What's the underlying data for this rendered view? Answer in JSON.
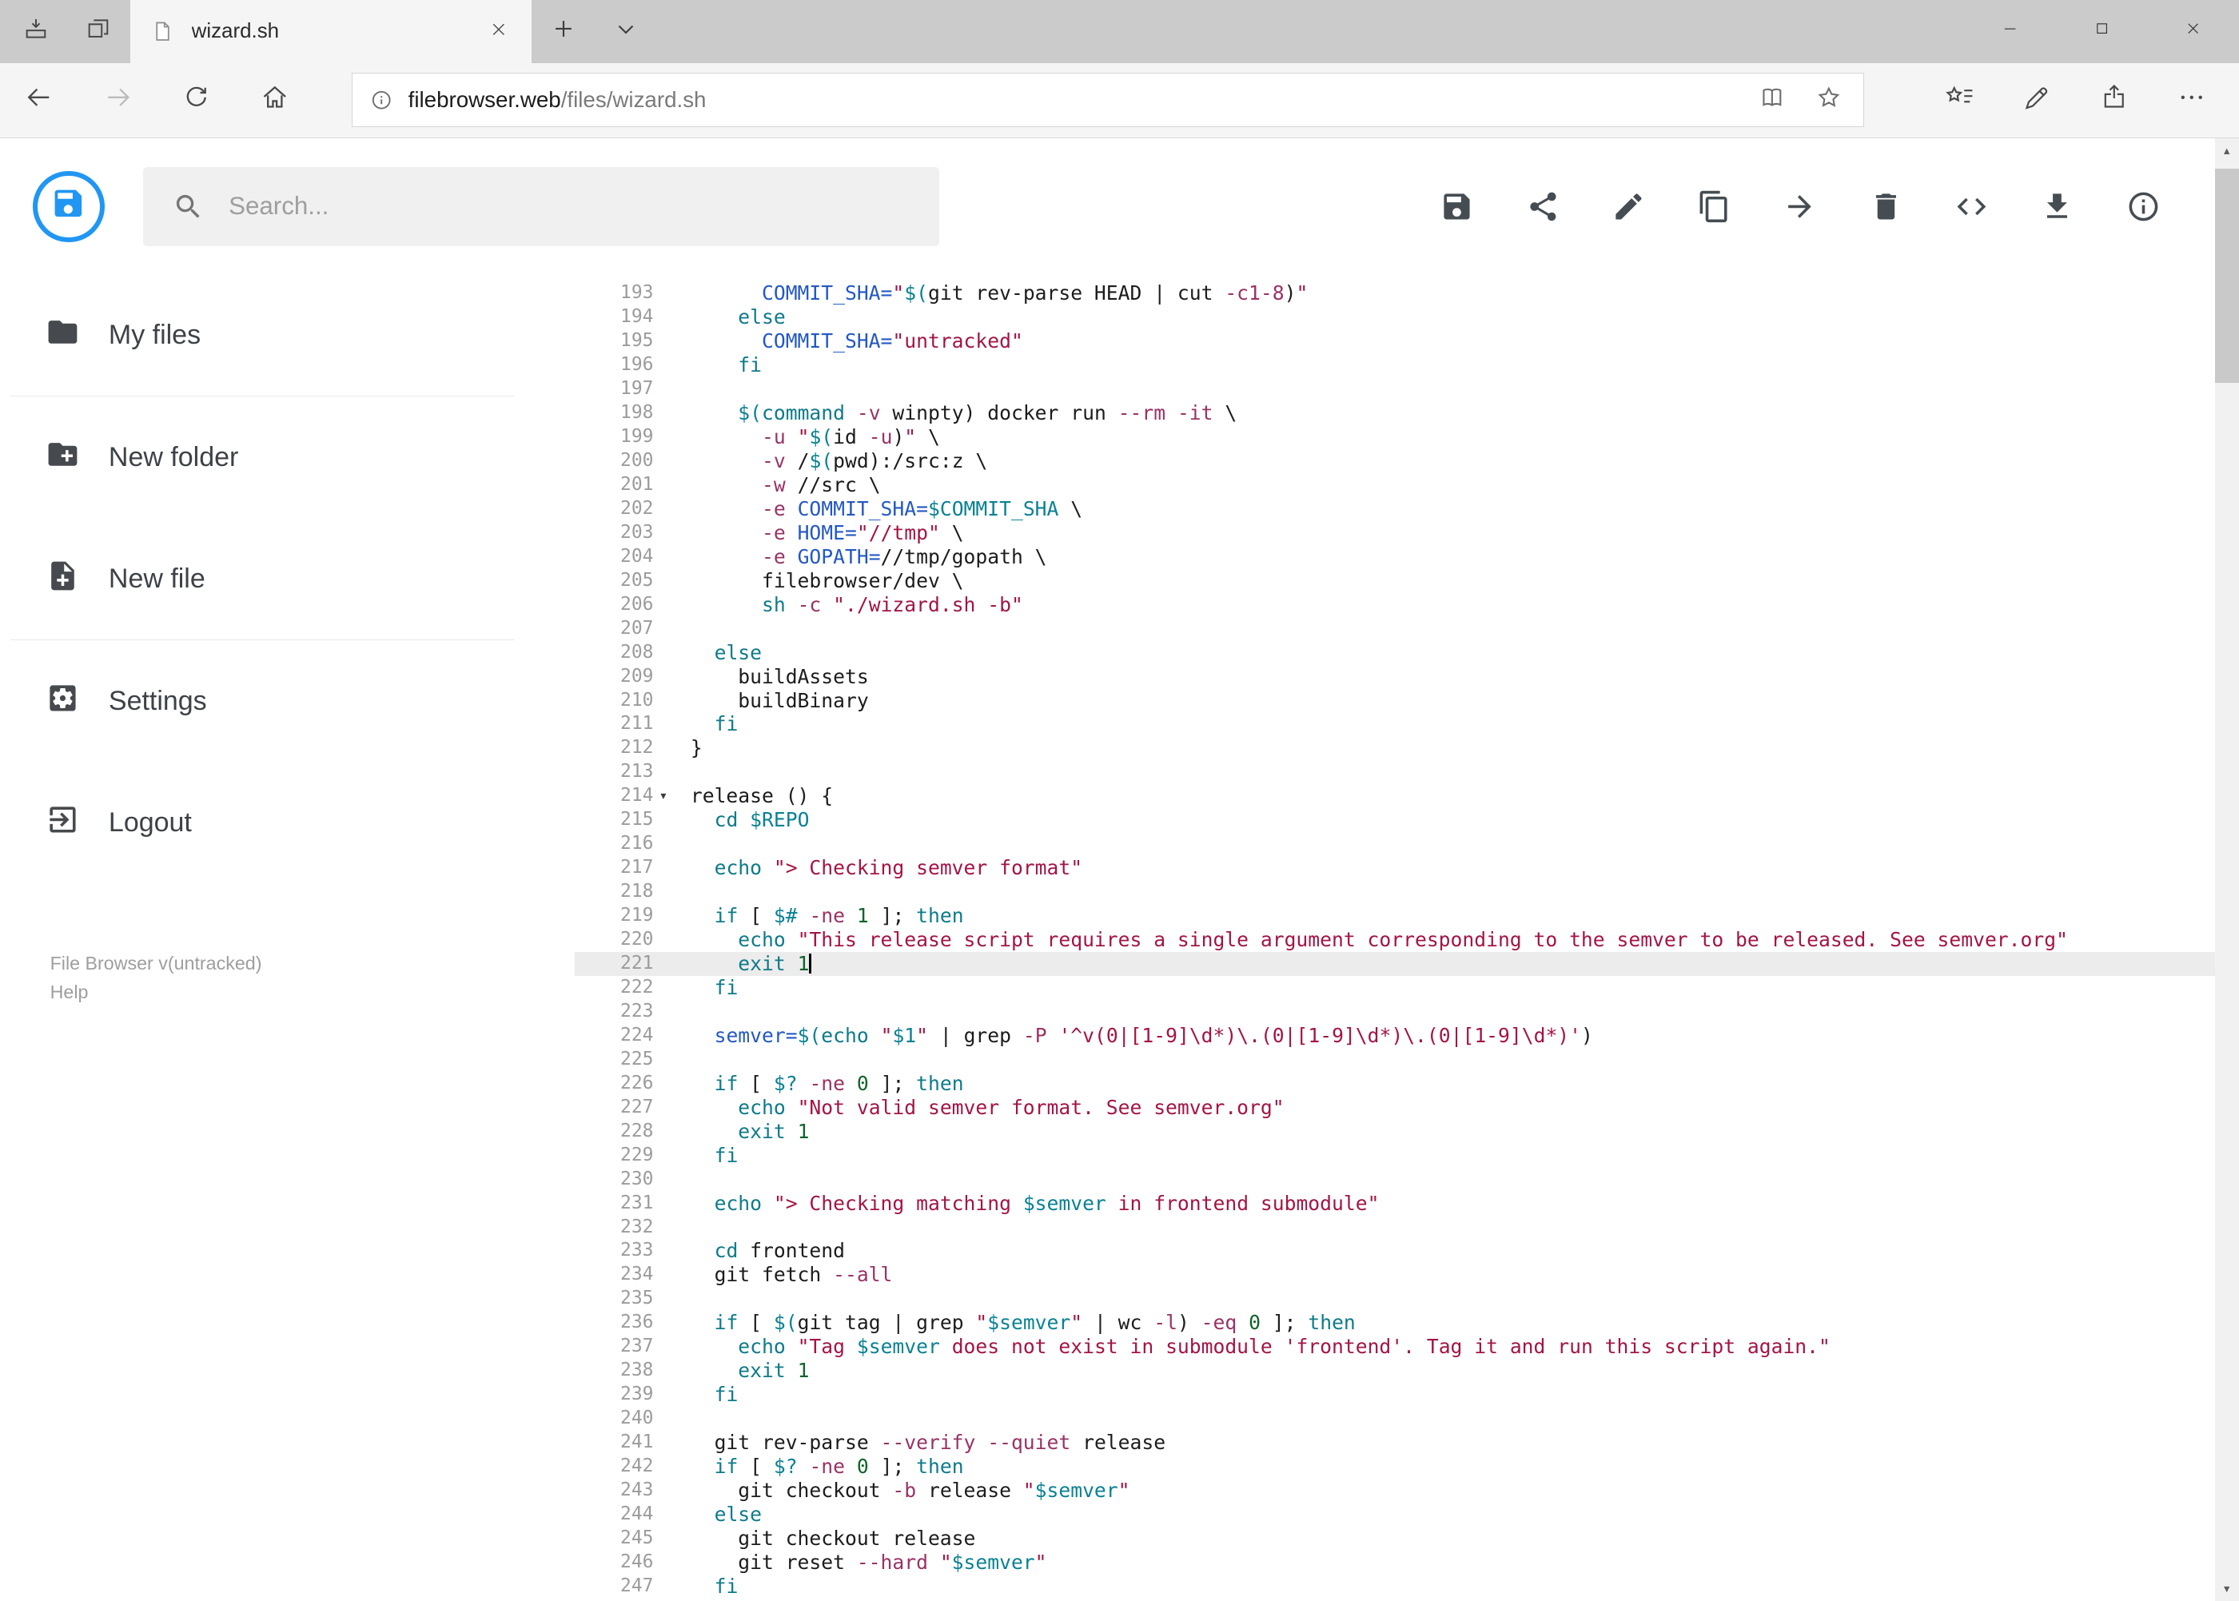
{
  "browser": {
    "tab_title": "wizard.sh",
    "address": {
      "host": "filebrowser.web",
      "path": "/files/wizard.sh"
    }
  },
  "app": {
    "search": {
      "placeholder": "Search..."
    },
    "toolbar_icons": [
      "save",
      "share",
      "edit",
      "copy",
      "move",
      "delete",
      "raw",
      "download",
      "info"
    ],
    "sidebar": {
      "items": [
        {
          "label": "My files"
        },
        {
          "label": "New folder"
        },
        {
          "label": "New file"
        },
        {
          "label": "Settings"
        },
        {
          "label": "Logout"
        }
      ],
      "footer": {
        "version": "File Browser v(untracked)",
        "help": "Help"
      }
    }
  },
  "theme": {
    "accent": "#2196f3",
    "active_line_bg": "#ececec",
    "tok_plain": "#1c1c1c",
    "tok_keyword": "#0e7b8a",
    "tok_string": "#a31545",
    "tok_def": "#2458c5",
    "tok_variable": "#0a8293",
    "tok_number": "#11632a",
    "tok_flag": "#993366"
  },
  "editor": {
    "active_line": 221,
    "cursor_line": 221,
    "fold_marker_line": 214,
    "fold_marker": "▾",
    "lines": [
      {
        "n": 193,
        "t": [
          [
            "p",
            "      "
          ],
          [
            "d",
            "COMMIT_SHA="
          ],
          [
            "s",
            "\""
          ],
          [
            "v",
            "$("
          ],
          [
            "p",
            "git rev-parse HEAD | cut "
          ],
          [
            "f",
            "-c1-8"
          ],
          [
            "p",
            ")"
          ],
          [
            "s",
            "\""
          ]
        ]
      },
      {
        "n": 194,
        "t": [
          [
            "p",
            "    "
          ],
          [
            "k",
            "else"
          ]
        ]
      },
      {
        "n": 195,
        "t": [
          [
            "p",
            "      "
          ],
          [
            "d",
            "COMMIT_SHA="
          ],
          [
            "s",
            "\"untracked\""
          ]
        ]
      },
      {
        "n": 196,
        "t": [
          [
            "p",
            "    "
          ],
          [
            "k",
            "fi"
          ]
        ]
      },
      {
        "n": 197,
        "t": []
      },
      {
        "n": 198,
        "t": [
          [
            "p",
            "    "
          ],
          [
            "v",
            "$("
          ],
          [
            "k",
            "command"
          ],
          [
            "p",
            " "
          ],
          [
            "f",
            "-v"
          ],
          [
            "p",
            " winpty) docker run "
          ],
          [
            "f",
            "--rm"
          ],
          [
            "p",
            " "
          ],
          [
            "f",
            "-it"
          ],
          [
            "p",
            " \\"
          ]
        ]
      },
      {
        "n": 199,
        "t": [
          [
            "p",
            "      "
          ],
          [
            "f",
            "-u"
          ],
          [
            "p",
            " "
          ],
          [
            "s",
            "\""
          ],
          [
            "v",
            "$("
          ],
          [
            "p",
            "id "
          ],
          [
            "f",
            "-u"
          ],
          [
            "p",
            ")"
          ],
          [
            "s",
            "\""
          ],
          [
            "p",
            " \\"
          ]
        ]
      },
      {
        "n": 200,
        "t": [
          [
            "p",
            "      "
          ],
          [
            "f",
            "-v"
          ],
          [
            "p",
            " /"
          ],
          [
            "v",
            "$("
          ],
          [
            "p",
            "pwd):/src:z \\"
          ]
        ]
      },
      {
        "n": 201,
        "t": [
          [
            "p",
            "      "
          ],
          [
            "f",
            "-w"
          ],
          [
            "p",
            " //src \\"
          ]
        ]
      },
      {
        "n": 202,
        "t": [
          [
            "p",
            "      "
          ],
          [
            "f",
            "-e"
          ],
          [
            "p",
            " "
          ],
          [
            "d",
            "COMMIT_SHA="
          ],
          [
            "v",
            "$COMMIT_SHA"
          ],
          [
            "p",
            " \\"
          ]
        ]
      },
      {
        "n": 203,
        "t": [
          [
            "p",
            "      "
          ],
          [
            "f",
            "-e"
          ],
          [
            "p",
            " "
          ],
          [
            "d",
            "HOME="
          ],
          [
            "s",
            "\"//tmp\""
          ],
          [
            "p",
            " \\"
          ]
        ]
      },
      {
        "n": 204,
        "t": [
          [
            "p",
            "      "
          ],
          [
            "f",
            "-e"
          ],
          [
            "p",
            " "
          ],
          [
            "d",
            "GOPATH="
          ],
          [
            "p",
            "//tmp/gopath \\"
          ]
        ]
      },
      {
        "n": 205,
        "t": [
          [
            "p",
            "      filebrowser/dev \\"
          ]
        ]
      },
      {
        "n": 206,
        "t": [
          [
            "p",
            "      "
          ],
          [
            "k",
            "sh"
          ],
          [
            "p",
            " "
          ],
          [
            "f",
            "-c"
          ],
          [
            "p",
            " "
          ],
          [
            "s",
            "\"./wizard.sh -b\""
          ]
        ]
      },
      {
        "n": 207,
        "t": []
      },
      {
        "n": 208,
        "t": [
          [
            "p",
            "  "
          ],
          [
            "k",
            "else"
          ]
        ]
      },
      {
        "n": 209,
        "t": [
          [
            "p",
            "    buildAssets"
          ]
        ]
      },
      {
        "n": 210,
        "t": [
          [
            "p",
            "    buildBinary"
          ]
        ]
      },
      {
        "n": 211,
        "t": [
          [
            "p",
            "  "
          ],
          [
            "k",
            "fi"
          ]
        ]
      },
      {
        "n": 212,
        "t": [
          [
            "p",
            "}"
          ]
        ]
      },
      {
        "n": 213,
        "t": []
      },
      {
        "n": 214,
        "t": [
          [
            "p",
            "release () {"
          ]
        ]
      },
      {
        "n": 215,
        "t": [
          [
            "p",
            "  "
          ],
          [
            "k",
            "cd"
          ],
          [
            "p",
            " "
          ],
          [
            "v",
            "$REPO"
          ]
        ]
      },
      {
        "n": 216,
        "t": []
      },
      {
        "n": 217,
        "t": [
          [
            "p",
            "  "
          ],
          [
            "k",
            "echo"
          ],
          [
            "p",
            " "
          ],
          [
            "s",
            "\"> Checking semver format\""
          ]
        ]
      },
      {
        "n": 218,
        "t": []
      },
      {
        "n": 219,
        "t": [
          [
            "p",
            "  "
          ],
          [
            "k",
            "if"
          ],
          [
            "p",
            " [ "
          ],
          [
            "v",
            "$#"
          ],
          [
            "p",
            " "
          ],
          [
            "f",
            "-ne"
          ],
          [
            "p",
            " "
          ],
          [
            "n",
            "1"
          ],
          [
            "p",
            " ]; "
          ],
          [
            "k",
            "then"
          ]
        ]
      },
      {
        "n": 220,
        "t": [
          [
            "p",
            "    "
          ],
          [
            "k",
            "echo"
          ],
          [
            "p",
            " "
          ],
          [
            "s",
            "\"This release script requires a single argument corresponding to the semver to be released. See semver.org\""
          ]
        ]
      },
      {
        "n": 221,
        "t": [
          [
            "p",
            "    "
          ],
          [
            "k",
            "exit"
          ],
          [
            "p",
            " "
          ],
          [
            "n",
            "1"
          ]
        ]
      },
      {
        "n": 222,
        "t": [
          [
            "p",
            "  "
          ],
          [
            "k",
            "fi"
          ]
        ]
      },
      {
        "n": 223,
        "t": []
      },
      {
        "n": 224,
        "t": [
          [
            "p",
            "  "
          ],
          [
            "d",
            "semver="
          ],
          [
            "v",
            "$("
          ],
          [
            "k",
            "echo"
          ],
          [
            "p",
            " "
          ],
          [
            "s",
            "\""
          ],
          [
            "v",
            "$1"
          ],
          [
            "s",
            "\""
          ],
          [
            "p",
            " | grep "
          ],
          [
            "f",
            "-P"
          ],
          [
            "p",
            " "
          ],
          [
            "s",
            "'^v(0|[1-9]\\d*)\\.(0|[1-9]\\d*)\\.(0|[1-9]\\d*)'"
          ],
          [
            "p",
            ")"
          ]
        ]
      },
      {
        "n": 225,
        "t": []
      },
      {
        "n": 226,
        "t": [
          [
            "p",
            "  "
          ],
          [
            "k",
            "if"
          ],
          [
            "p",
            " [ "
          ],
          [
            "v",
            "$?"
          ],
          [
            "p",
            " "
          ],
          [
            "f",
            "-ne"
          ],
          [
            "p",
            " "
          ],
          [
            "n",
            "0"
          ],
          [
            "p",
            " ]; "
          ],
          [
            "k",
            "then"
          ]
        ]
      },
      {
        "n": 227,
        "t": [
          [
            "p",
            "    "
          ],
          [
            "k",
            "echo"
          ],
          [
            "p",
            " "
          ],
          [
            "s",
            "\"Not valid semver format. See semver.org\""
          ]
        ]
      },
      {
        "n": 228,
        "t": [
          [
            "p",
            "    "
          ],
          [
            "k",
            "exit"
          ],
          [
            "p",
            " "
          ],
          [
            "n",
            "1"
          ]
        ]
      },
      {
        "n": 229,
        "t": [
          [
            "p",
            "  "
          ],
          [
            "k",
            "fi"
          ]
        ]
      },
      {
        "n": 230,
        "t": []
      },
      {
        "n": 231,
        "t": [
          [
            "p",
            "  "
          ],
          [
            "k",
            "echo"
          ],
          [
            "p",
            " "
          ],
          [
            "s",
            "\"> Checking matching "
          ],
          [
            "v",
            "$semver"
          ],
          [
            "s",
            " in frontend submodule\""
          ]
        ]
      },
      {
        "n": 232,
        "t": []
      },
      {
        "n": 233,
        "t": [
          [
            "p",
            "  "
          ],
          [
            "k",
            "cd"
          ],
          [
            "p",
            " frontend"
          ]
        ]
      },
      {
        "n": 234,
        "t": [
          [
            "p",
            "  git fetch "
          ],
          [
            "f",
            "--all"
          ]
        ]
      },
      {
        "n": 235,
        "t": []
      },
      {
        "n": 236,
        "t": [
          [
            "p",
            "  "
          ],
          [
            "k",
            "if"
          ],
          [
            "p",
            " [ "
          ],
          [
            "v",
            "$("
          ],
          [
            "p",
            "git tag | grep "
          ],
          [
            "s",
            "\""
          ],
          [
            "v",
            "$semver"
          ],
          [
            "s",
            "\""
          ],
          [
            "p",
            " | wc "
          ],
          [
            "f",
            "-l"
          ],
          [
            "p",
            ") "
          ],
          [
            "f",
            "-eq"
          ],
          [
            "p",
            " "
          ],
          [
            "n",
            "0"
          ],
          [
            "p",
            " ]; "
          ],
          [
            "k",
            "then"
          ]
        ]
      },
      {
        "n": 237,
        "t": [
          [
            "p",
            "    "
          ],
          [
            "k",
            "echo"
          ],
          [
            "p",
            " "
          ],
          [
            "s",
            "\"Tag "
          ],
          [
            "v",
            "$semver"
          ],
          [
            "s",
            " does not exist in submodule 'frontend'. Tag it and run this script again.\""
          ]
        ]
      },
      {
        "n": 238,
        "t": [
          [
            "p",
            "    "
          ],
          [
            "k",
            "exit"
          ],
          [
            "p",
            " "
          ],
          [
            "n",
            "1"
          ]
        ]
      },
      {
        "n": 239,
        "t": [
          [
            "p",
            "  "
          ],
          [
            "k",
            "fi"
          ]
        ]
      },
      {
        "n": 240,
        "t": []
      },
      {
        "n": 241,
        "t": [
          [
            "p",
            "  git rev-parse "
          ],
          [
            "f",
            "--verify"
          ],
          [
            "p",
            " "
          ],
          [
            "f",
            "--quiet"
          ],
          [
            "p",
            " release"
          ]
        ]
      },
      {
        "n": 242,
        "t": [
          [
            "p",
            "  "
          ],
          [
            "k",
            "if"
          ],
          [
            "p",
            " [ "
          ],
          [
            "v",
            "$?"
          ],
          [
            "p",
            " "
          ],
          [
            "f",
            "-ne"
          ],
          [
            "p",
            " "
          ],
          [
            "n",
            "0"
          ],
          [
            "p",
            " ]; "
          ],
          [
            "k",
            "then"
          ]
        ]
      },
      {
        "n": 243,
        "t": [
          [
            "p",
            "    git checkout "
          ],
          [
            "f",
            "-b"
          ],
          [
            "p",
            " release "
          ],
          [
            "s",
            "\""
          ],
          [
            "v",
            "$semver"
          ],
          [
            "s",
            "\""
          ]
        ]
      },
      {
        "n": 244,
        "t": [
          [
            "p",
            "  "
          ],
          [
            "k",
            "else"
          ]
        ]
      },
      {
        "n": 245,
        "t": [
          [
            "p",
            "    git checkout release"
          ]
        ]
      },
      {
        "n": 246,
        "t": [
          [
            "p",
            "    git reset "
          ],
          [
            "f",
            "--hard"
          ],
          [
            "p",
            " "
          ],
          [
            "s",
            "\""
          ],
          [
            "v",
            "$semver"
          ],
          [
            "s",
            "\""
          ]
        ]
      },
      {
        "n": 247,
        "t": [
          [
            "p",
            "  "
          ],
          [
            "k",
            "fi"
          ]
        ]
      }
    ]
  }
}
